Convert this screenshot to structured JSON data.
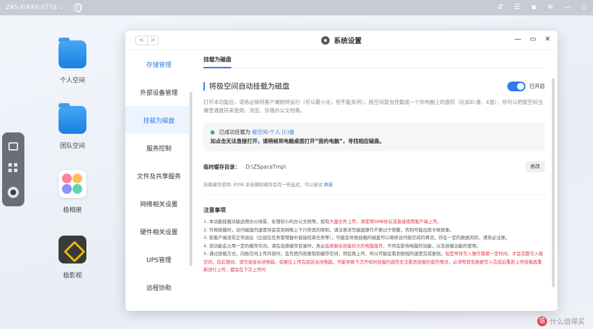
{
  "topbar": {
    "device_name": "Z4S-XIXXX-0779 ⌄",
    "icons": [
      "pin-icon",
      "tasks-icon",
      "profile-icon",
      "settings-icon",
      "minimize-icon",
      "window-icon"
    ]
  },
  "desktop": {
    "icons": [
      {
        "label": "个人空间",
        "icon": "personal-folder-icon"
      },
      {
        "label": "团队空间",
        "icon": "team-folder-icon"
      },
      {
        "label": "极相册",
        "icon": "photos-icon"
      },
      {
        "label": "极影视",
        "icon": "video-icon"
      }
    ]
  },
  "window": {
    "title": "系统设置",
    "nav": {
      "back": "<",
      "forward": ">"
    },
    "controls": {
      "minimize": "—",
      "maximize": "▭",
      "close": "✕"
    }
  },
  "sidebar": {
    "items": [
      {
        "label": "存储管理",
        "state": "highlighted"
      },
      {
        "label": "外部设备管理",
        "state": "normal"
      },
      {
        "label": "挂载为磁盘",
        "state": "active"
      },
      {
        "label": "服务控制",
        "state": "normal"
      },
      {
        "label": "文件及共享服务",
        "state": "normal"
      },
      {
        "label": "网络相关设置",
        "state": "normal"
      },
      {
        "label": "硬件相关设置",
        "state": "normal"
      },
      {
        "label": "UPS管理",
        "state": "normal"
      },
      {
        "label": "远程协助",
        "state": "normal"
      }
    ]
  },
  "content": {
    "tab": "挂载为磁盘",
    "section_title": "将极空间自动挂载为磁盘",
    "toggle_label": "已开启",
    "toggle_on": true,
    "description": "打开本功能后，请务必保持客户端始终运行（可以最小化，但不能关闭），极空间就会挂载成一个你电脑上的盘符（比如D:盘、E盘），你可以把极空间当做普通盘符来使用、浏览、存储办公文档等。",
    "status": {
      "prefix": "已成功挂载为",
      "link": "极空间-个人 (I:)盘",
      "hint": "如点击无法直接打开，请稍候到电脑桌面打开“我的电脑”，寻找相应磁盘。"
    },
    "cache": {
      "label": "临时缓存目录：",
      "path": "D:\\ZSpaceTmp\\",
      "modify_button": "修改",
      "usage_text": "挂载缓存使用:  约0B   系统删除缓存会有一些延迟，可以尝试",
      "clear_link": "刷新"
    },
    "notes_title": "注意事项",
    "notes": [
      {
        "text": "1. 本功能挂载功能适用办公场景、处理较小的办公文档等。如有",
        "red": "大量文件上传、请使用SMB协议或直接使用客户端上传。"
      },
      {
        "text": "2. 外网挂载时，访问磁盘的速度将会受到网络上下行带宽的限制，请注意读写磁盘操作不要过于频繁，否则可能出现卡顿现象。",
        "red": ""
      },
      {
        "text": "3. 如客户端没有正常退出（比如在任务管理器中直接结束任务等），可能会导致挂载的磁盘可以继续访问极空间的情况，存在一定的数据风险，请务必注意。",
        "red": ""
      },
      {
        "text": "4. 该功能会占用一定的缓存空间，请在选择缓存目录时，务必",
        "red": "选择剩余容量较大的电脑盘符",
        "tail": "，不然会影响电脑的功能，以及挂载功能的使用。"
      },
      {
        "text": "5. 通过挂载方式，向极空间上传内容时，会先把内容复制到缓存空间，然后再上传，所以可能会看到很短的速度完成复制。",
        "red": "但是等待写入操作需要一定时间，才会完整写入极空间，在此期间，请勿直接关闭电脑。如果在上传完成前关闭电脑，可能导致下次开机时挂载的盘符无法看到挂载的盘符情况，必须等其有数据写入完成后重新上传挂载再重新进行上传，都会在下次上传时"
      }
    ]
  },
  "watermark": {
    "logo": "值",
    "text": "什么值得买"
  }
}
